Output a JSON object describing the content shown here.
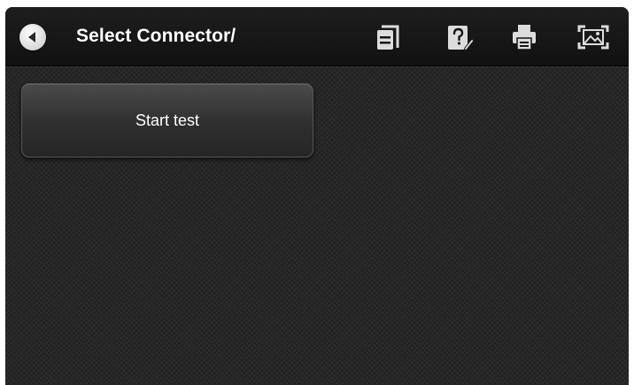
{
  "header": {
    "title": "Select Connector/",
    "back_icon": "back-arrow-icon",
    "tools": [
      {
        "name": "document-icon"
      },
      {
        "name": "help-icon"
      },
      {
        "name": "printer-icon"
      },
      {
        "name": "screenshot-icon"
      }
    ]
  },
  "main": {
    "start_button_label": "Start test"
  },
  "colors": {
    "background": "#2b2b2b",
    "topbar": "#151515",
    "text": "#ffffff",
    "icon": "#dcdcdc"
  }
}
